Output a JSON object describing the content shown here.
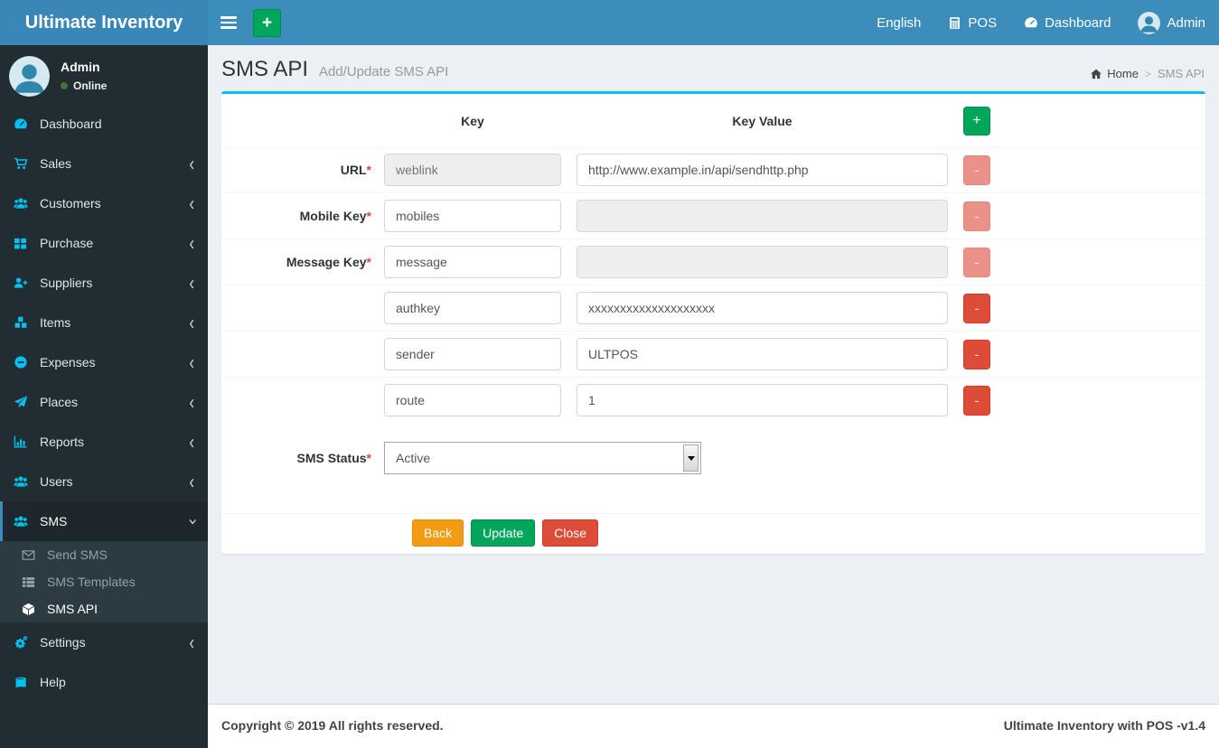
{
  "colors": {
    "navbar": "#3c8dbc",
    "sidebar": "#222d32",
    "sidebar_active_bg": "#1e282c",
    "submenu_bg": "#2c3b41",
    "icon_accent": "#00c0ef",
    "box_top_accent": "#00c0ef",
    "green": "#00a65a",
    "orange": "#f39c12",
    "red": "#dd4b39",
    "content_bg": "#ecf0f5"
  },
  "brand": {
    "title": "Ultimate Inventory"
  },
  "navbar": {
    "add_button": "+",
    "language": "English",
    "pos": "POS",
    "dashboard": "Dashboard",
    "user": "Admin"
  },
  "user_panel": {
    "name": "Admin",
    "status": "Online"
  },
  "sidebar": {
    "chevron_glyph": "‹",
    "items": [
      {
        "label": "Dashboard",
        "icon": "tachometer-icon"
      },
      {
        "label": "Sales",
        "icon": "cart-icon"
      },
      {
        "label": "Customers",
        "icon": "users-icon"
      },
      {
        "label": "Purchase",
        "icon": "th-large-icon"
      },
      {
        "label": "Suppliers",
        "icon": "user-plus-icon"
      },
      {
        "label": "Items",
        "icon": "cubes-icon"
      },
      {
        "label": "Expenses",
        "icon": "minus-circle-icon"
      },
      {
        "label": "Places",
        "icon": "paper-plane-icon"
      },
      {
        "label": "Reports",
        "icon": "bar-chart-icon"
      },
      {
        "label": "Users",
        "icon": "users-icon"
      },
      {
        "label": "SMS",
        "icon": "users-icon"
      },
      {
        "label": "Settings",
        "icon": "gears-icon"
      },
      {
        "label": "Help",
        "icon": "book-icon"
      }
    ],
    "sms_children": [
      {
        "label": "Send SMS",
        "icon": "envelope-icon"
      },
      {
        "label": "SMS Templates",
        "icon": "th-list-icon"
      },
      {
        "label": "SMS API",
        "icon": "cube-icon"
      }
    ]
  },
  "page": {
    "title": "SMS API",
    "subtitle": "Add/Update SMS API",
    "breadcrumb_home": "Home",
    "breadcrumb_sep": ">",
    "breadcrumb_current": "SMS API"
  },
  "form": {
    "key_header": "Key",
    "value_header": "Key Value",
    "add_label": "+",
    "remove_label": "-",
    "required_mark": "*",
    "rows": [
      {
        "label": "URL",
        "key": "weblink",
        "value": "http://www.example.in/api/sendhttp.php"
      },
      {
        "label": "Mobile Key",
        "key": "mobiles",
        "value": ""
      },
      {
        "label": "Message Key",
        "key": "message",
        "value": ""
      },
      {
        "label": "",
        "key": "authkey",
        "value": "xxxxxxxxxxxxxxxxxxxx"
      },
      {
        "label": "",
        "key": "sender",
        "value": "ULTPOS"
      },
      {
        "label": "",
        "key": "route",
        "value": "1"
      }
    ],
    "status_label": "SMS Status",
    "status_value": "Active",
    "buttons": {
      "back": "Back",
      "update": "Update",
      "close": "Close"
    }
  },
  "footer": {
    "left": "Copyright © 2019 All rights reserved.",
    "right": "Ultimate Inventory with POS -v1.4"
  }
}
